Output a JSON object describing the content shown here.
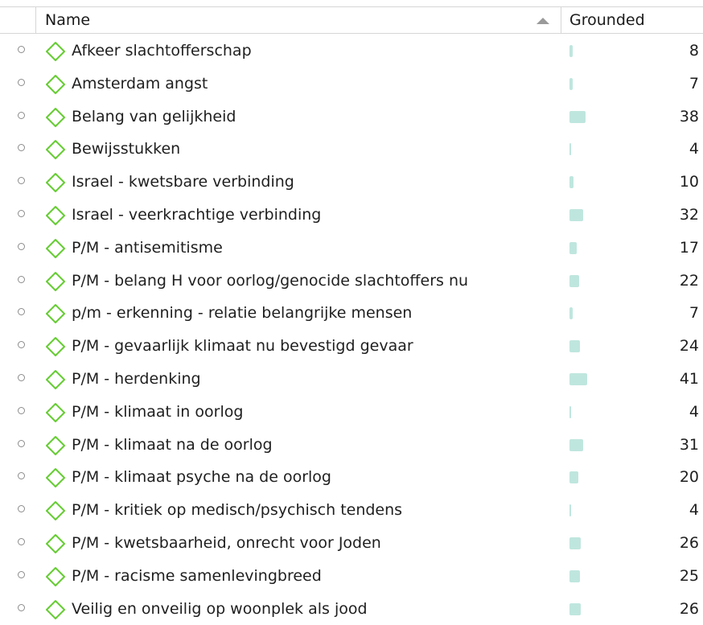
{
  "header": {
    "name_label": "Name",
    "grounded_label": "Grounded"
  },
  "colors": {
    "code_icon": "#66cc33",
    "bar": "#bfe6de"
  },
  "rows": [
    {
      "name": "Afkeer slachtofferschap",
      "grounded": "8"
    },
    {
      "name": "Amsterdam angst",
      "grounded": "7"
    },
    {
      "name": "Belang van gelijkheid",
      "grounded": "38"
    },
    {
      "name": "Bewijsstukken",
      "grounded": "4"
    },
    {
      "name": "Israel - kwetsbare verbinding",
      "grounded": "10"
    },
    {
      "name": "Israel - veerkrachtige verbinding",
      "grounded": "32"
    },
    {
      "name": "P/M - antisemitisme",
      "grounded": "17"
    },
    {
      "name": "P/M - belang H voor oorlog/genocide slachtoffers nu",
      "grounded": "22"
    },
    {
      "name": "p/m - erkenning - relatie belangrijke mensen",
      "grounded": "7"
    },
    {
      "name": "P/M - gevaarlijk klimaat nu bevestigd gevaar",
      "grounded": "24"
    },
    {
      "name": "P/M - herdenking",
      "grounded": "41"
    },
    {
      "name": "P/M - klimaat in oorlog",
      "grounded": "4"
    },
    {
      "name": "P/M - klimaat na de oorlog",
      "grounded": "31"
    },
    {
      "name": "P/M - klimaat psyche na de oorlog",
      "grounded": "20"
    },
    {
      "name": "P/M - kritiek op medisch/psychisch tendens",
      "grounded": "4"
    },
    {
      "name": "P/M - kwetsbaarheid, onrecht voor Joden",
      "grounded": "26"
    },
    {
      "name": "P/M - racisme samenlevingbreed",
      "grounded": "25"
    },
    {
      "name": "Veilig en onveilig op woonplek als jood",
      "grounded": "26"
    }
  ]
}
